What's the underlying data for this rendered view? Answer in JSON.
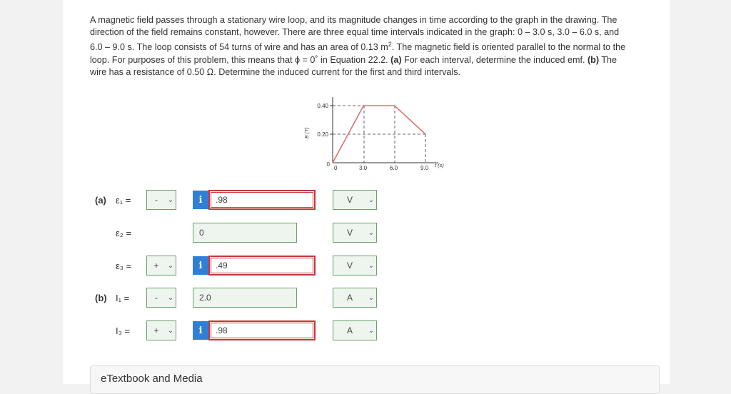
{
  "problem": {
    "line1": "A magnetic field passes through a stationary wire loop, and its magnitude changes in time according to the graph in the drawing. The",
    "line2": "direction of the field remains constant, however. There are three equal time intervals indicated in the graph: 0 – 3.0 s, 3.0 – 6.0 s, and",
    "line3a": "6.0 – 9.0 s. The loop consists of 54 turns of wire and has an area of 0.13 m",
    "line3sup": "2",
    "line3b": ". The magnetic field is oriented parallel to the normal to the",
    "line4a": "loop. For purposes of this problem, this means that ϕ = 0˚ in Equation 22.2. ",
    "line4b": "(a)",
    "line4c": " For each interval, determine the induced emf. ",
    "line4d": "(b)",
    "line4e": " The",
    "line5": "wire has a resistance of 0.50 Ω. Determine the induced current for the first and third intervals."
  },
  "graph": {
    "ylabel": "B (T)",
    "xlabel": "t (s)",
    "yticks": [
      "0.40",
      "0.20",
      "0"
    ],
    "xticks": [
      "0",
      "3.0",
      "6.0",
      "9.0"
    ],
    "points": [
      [
        0,
        0
      ],
      [
        3.0,
        0.4
      ],
      [
        6.0,
        0.4
      ],
      [
        9.0,
        0.2
      ]
    ],
    "line_color": "#e07070"
  },
  "parts": {
    "a_label": "(a)",
    "b_label": "(b)"
  },
  "rows": [
    {
      "label": "ε₁ =",
      "sign": "-",
      "has_info": true,
      "value": ".98",
      "status": "wrong",
      "unit": "V"
    },
    {
      "label": "ε₂ =",
      "sign": null,
      "has_info": false,
      "value": "0",
      "status": "right",
      "unit": "V"
    },
    {
      "label": "ε₃ =",
      "sign": "+",
      "has_info": true,
      "value": ".49",
      "status": "wrong",
      "unit": "V"
    },
    {
      "label": "I₁ =",
      "sign": "-",
      "has_info": false,
      "value": "2.0",
      "status": "right",
      "unit": "A"
    },
    {
      "label": "I₃ =",
      "sign": "+",
      "has_info": true,
      "value": ".98",
      "status": "wrong",
      "unit": "A"
    }
  ],
  "info_glyph": "i",
  "chevron": "⌄",
  "etextbook": "eTextbook and Media"
}
